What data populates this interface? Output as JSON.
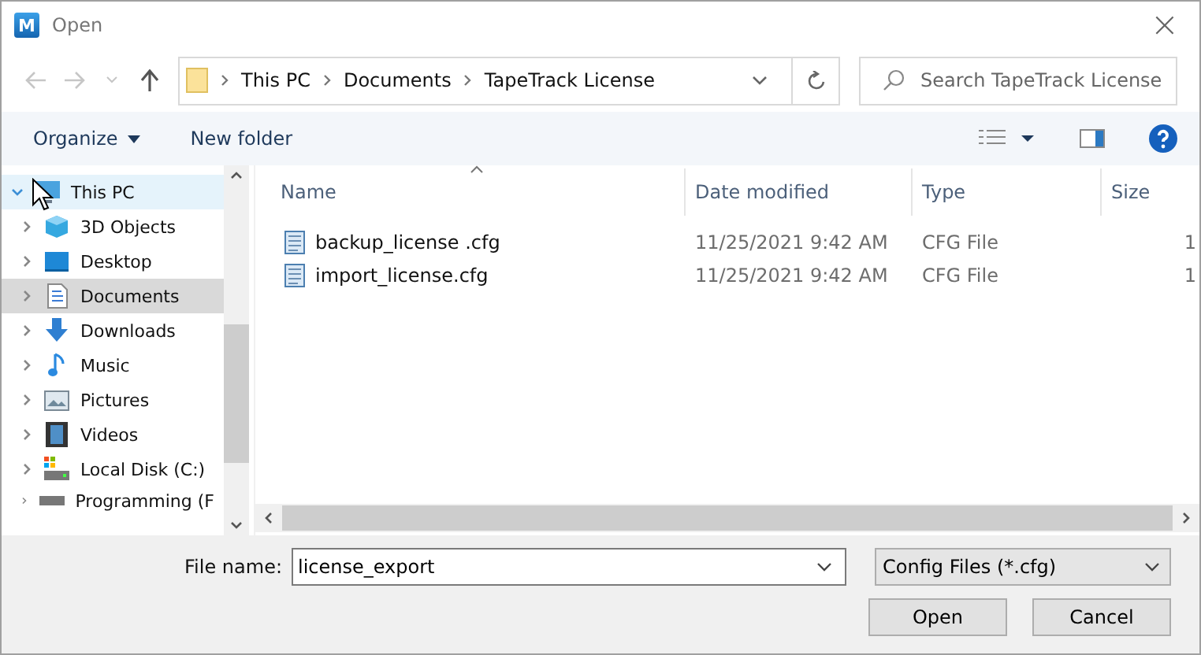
{
  "window": {
    "logo": "M",
    "title": "Open",
    "close": "×"
  },
  "address": {
    "path": [
      "This PC",
      "Documents",
      "TapeTrack License"
    ]
  },
  "search": {
    "placeholder": "Search TapeTrack License"
  },
  "toolbar": {
    "organize": "Organize",
    "new_folder": "New folder"
  },
  "nav": {
    "items": [
      {
        "label": "This PC",
        "kind": "pc",
        "expanded": true,
        "selected": false,
        "hovered": true,
        "children": [
          {
            "label": "3D Objects",
            "kind": "objects",
            "expanded": false,
            "selected": false,
            "hovered": false
          },
          {
            "label": "Desktop",
            "kind": "desktop",
            "expanded": false,
            "selected": false,
            "hovered": false
          },
          {
            "label": "Documents",
            "kind": "documents",
            "expanded": false,
            "selected": true,
            "hovered": false
          },
          {
            "label": "Downloads",
            "kind": "downloads",
            "expanded": false,
            "selected": false,
            "hovered": false
          },
          {
            "label": "Music",
            "kind": "music",
            "expanded": false,
            "selected": false,
            "hovered": false
          },
          {
            "label": "Pictures",
            "kind": "pictures",
            "expanded": false,
            "selected": false,
            "hovered": false
          },
          {
            "label": "Videos",
            "kind": "videos",
            "expanded": false,
            "selected": false,
            "hovered": false
          },
          {
            "label": "Local Disk (C:)",
            "kind": "disk",
            "expanded": false,
            "selected": false,
            "hovered": false
          },
          {
            "label": "Programming (F",
            "kind": "drive",
            "expanded": false,
            "selected": false,
            "hovered": false
          }
        ]
      }
    ]
  },
  "table": {
    "columns": [
      "Name",
      "Date modified",
      "Type",
      "Size"
    ],
    "rows": [
      {
        "name": "backup_license .cfg",
        "date": "11/25/2021 9:42 AM",
        "type": "CFG File",
        "size": "1"
      },
      {
        "name": "import_license.cfg",
        "date": "11/25/2021 9:42 AM",
        "type": "CFG File",
        "size": "1"
      }
    ]
  },
  "footer": {
    "file_name_label": "File name:",
    "file_name": "license_export",
    "filter": "Config Files (*.cfg)",
    "open": "Open",
    "cancel": "Cancel"
  }
}
